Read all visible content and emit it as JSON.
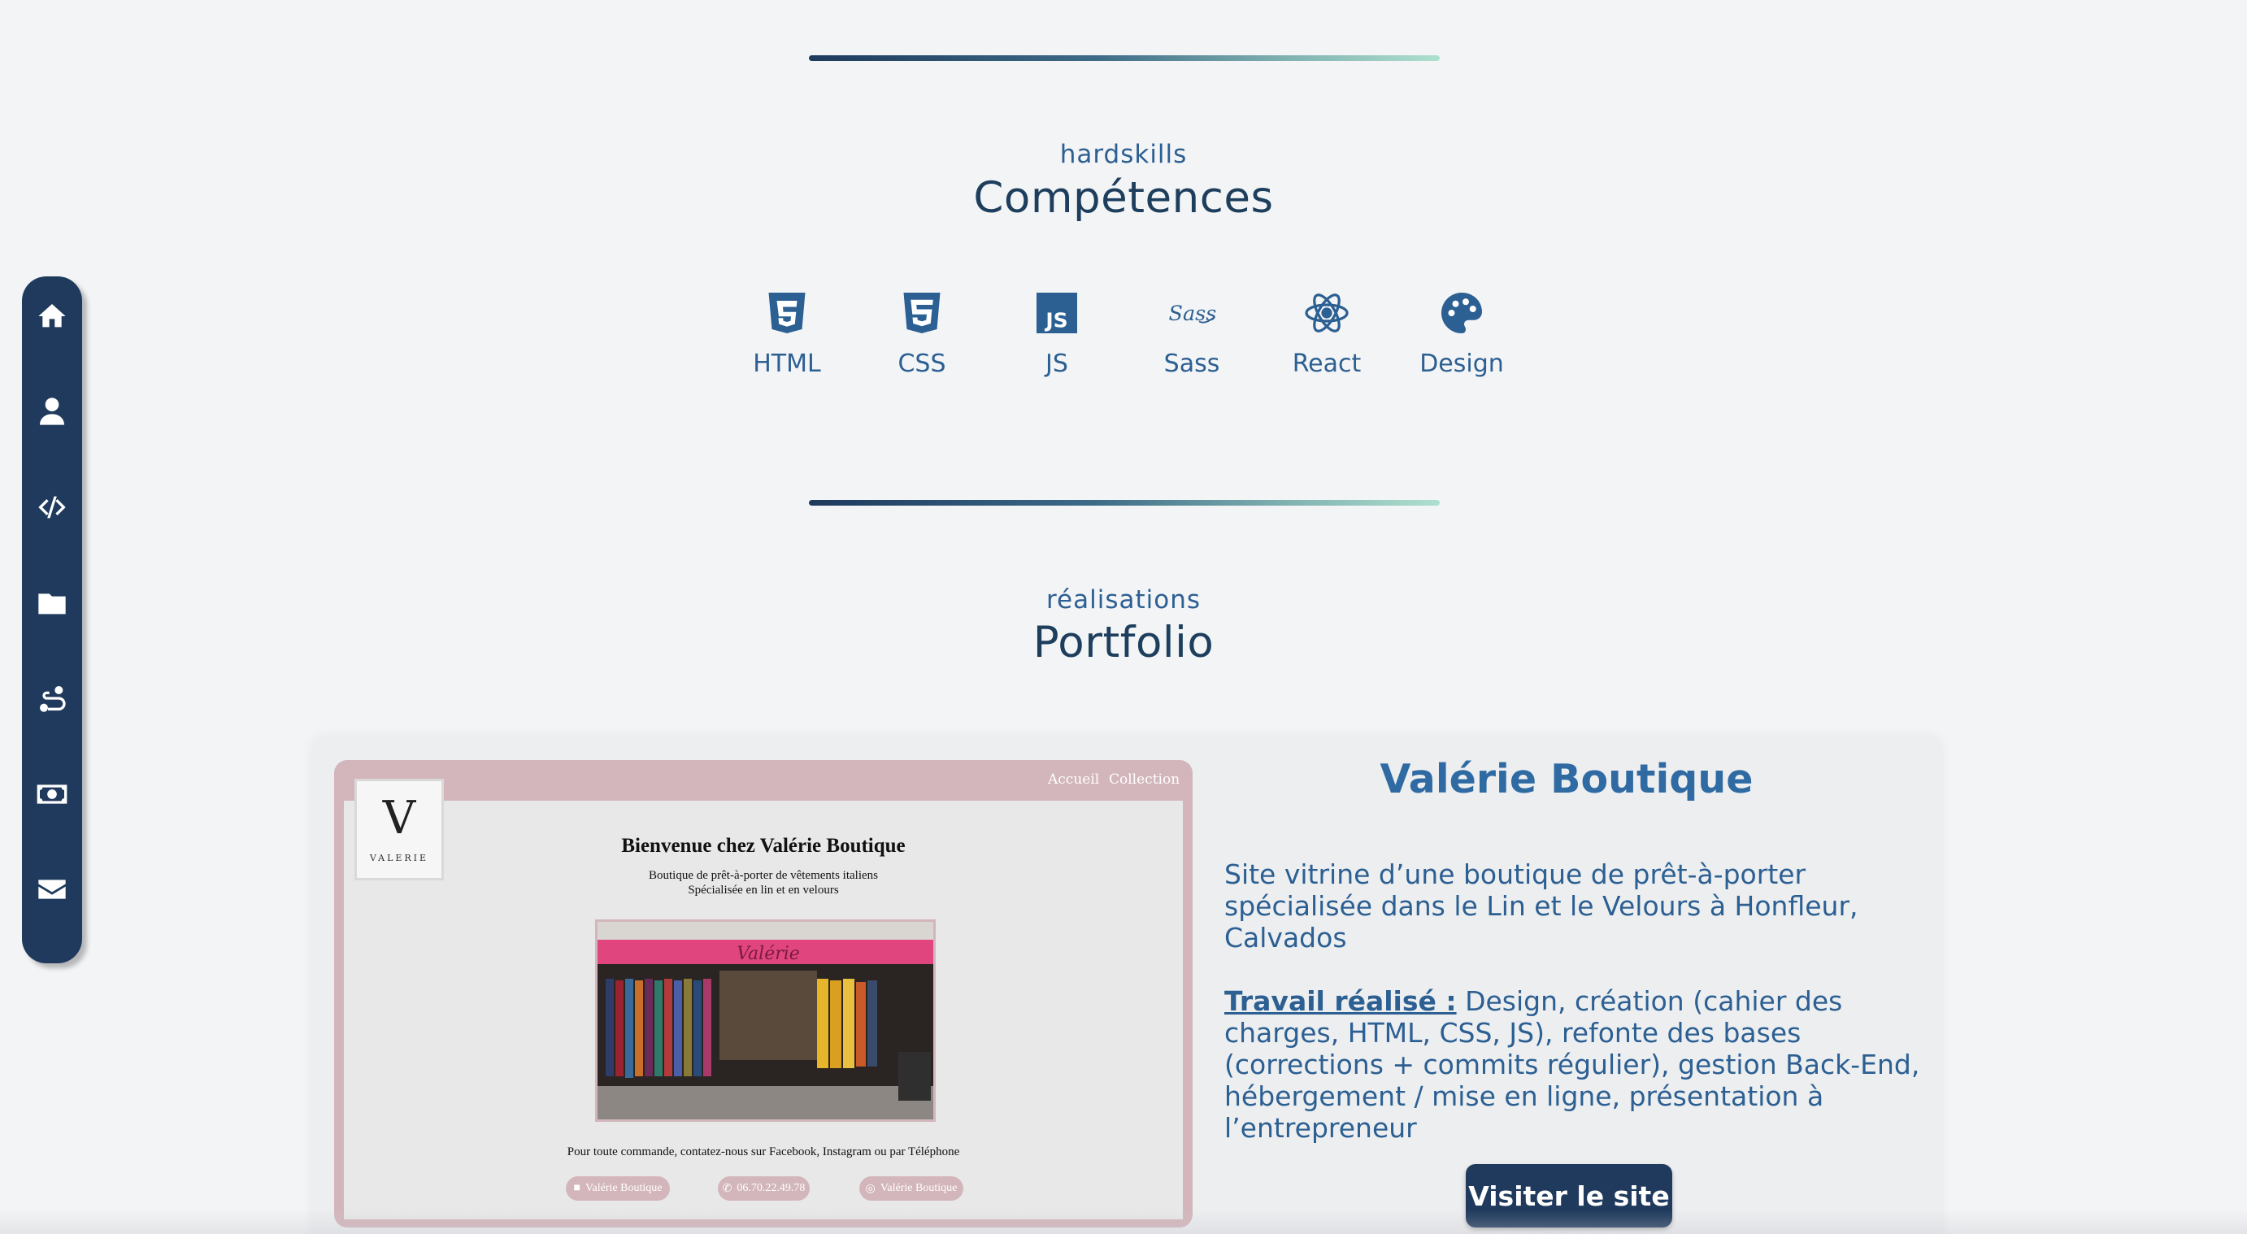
{
  "sidebar": {
    "items": [
      {
        "icon": "home-icon"
      },
      {
        "icon": "user-icon"
      },
      {
        "icon": "code-icon"
      },
      {
        "icon": "folder-icon"
      },
      {
        "icon": "route-icon"
      },
      {
        "icon": "money-bill-icon"
      },
      {
        "icon": "envelope-icon"
      }
    ]
  },
  "skills_section": {
    "subtitle": "hardskills",
    "title": "Compétences",
    "skills": [
      {
        "label": "HTML",
        "icon": "html5-icon"
      },
      {
        "label": "CSS",
        "icon": "css3-icon"
      },
      {
        "label": "JS",
        "icon": "js-icon"
      },
      {
        "label": "Sass",
        "icon": "sass-icon"
      },
      {
        "label": "React",
        "icon": "react-icon"
      },
      {
        "label": "Design",
        "icon": "palette-icon"
      }
    ]
  },
  "portfolio_section": {
    "subtitle": "réalisations",
    "title": "Portfolio"
  },
  "project": {
    "title": "Valérie Boutique",
    "description": "Site vitrine d’une boutique de prêt-à-porter spécialisée dans le Lin et le Velours à Honfleur, Calvados",
    "work_label": "Travail réalisé :",
    "work_text": "Design, création (cahier des charges, HTML, CSS, JS), refonte des bases (corrections + commits régulier), gestion Back-End, hébergement / mise en ligne, présentation à l’entrepreneur",
    "visit_label": "Visiter le site"
  },
  "preview": {
    "nav": [
      "Accueil",
      "Collection"
    ],
    "logo_letter": "V",
    "logo_name": "VALERIE",
    "heading": "Bienvenue chez Valérie Boutique",
    "line1": "Boutique de prêt-à-porter de vêtements italiens",
    "line2": "Spécialisée en lin et en velours",
    "awning_text": "Valérie",
    "contact": "Pour toute commande, contatez-nous sur Facebook, Instagram ou par Téléphone",
    "pills": [
      "Valérie Boutique",
      "06.70.22.49.78",
      "Valérie Boutique"
    ]
  },
  "colors": {
    "navy": "#1f3a5c",
    "accent_blue": "#2f6aa3",
    "background": "#f3f4f6",
    "preview_pink": "#d3b6bb"
  }
}
